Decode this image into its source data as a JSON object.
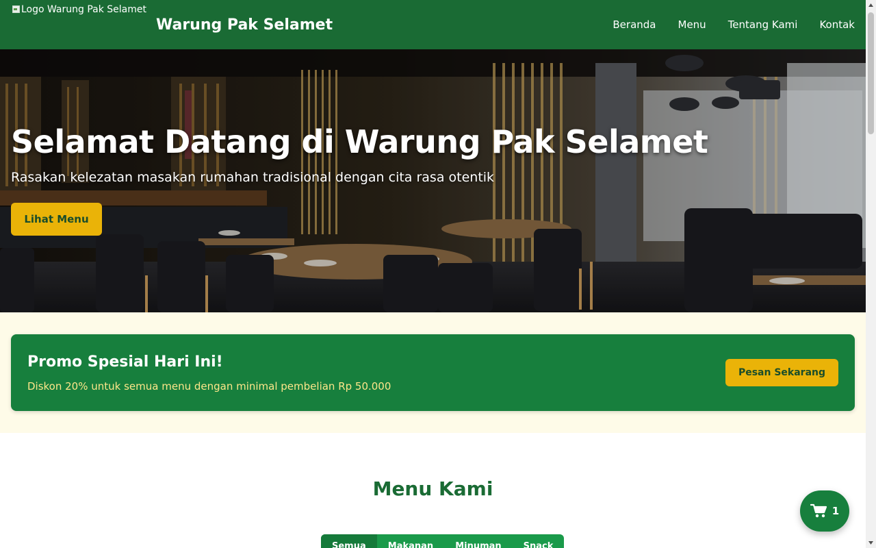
{
  "header": {
    "logo_alt": "Logo Warung Pak Selamet",
    "brand": "Warung Pak Selamet",
    "nav": [
      "Beranda",
      "Menu",
      "Tentang Kami",
      "Kontak"
    ]
  },
  "hero": {
    "title": "Selamat Datang di Warung Pak Selamet",
    "subtitle": "Rasakan kelezatan masakan rumahan tradisional dengan cita rasa otentik",
    "button": "Lihat Menu"
  },
  "promo": {
    "title": "Promo Spesial Hari Ini!",
    "description": "Diskon 20% untuk semua menu dengan minimal pembelian Rp 50.000",
    "button": "Pesan Sekarang"
  },
  "menu": {
    "title": "Menu Kami",
    "tabs": [
      "Semua",
      "Makanan",
      "Minuman",
      "Snack"
    ],
    "active_tab": "Semua"
  },
  "cart": {
    "icon": "cart-icon",
    "count": "1"
  },
  "colors": {
    "primary_green": "#1a6b34",
    "promo_green": "#177f3d",
    "accent_yellow": "#eab308",
    "promo_bg": "#fefbe8"
  }
}
